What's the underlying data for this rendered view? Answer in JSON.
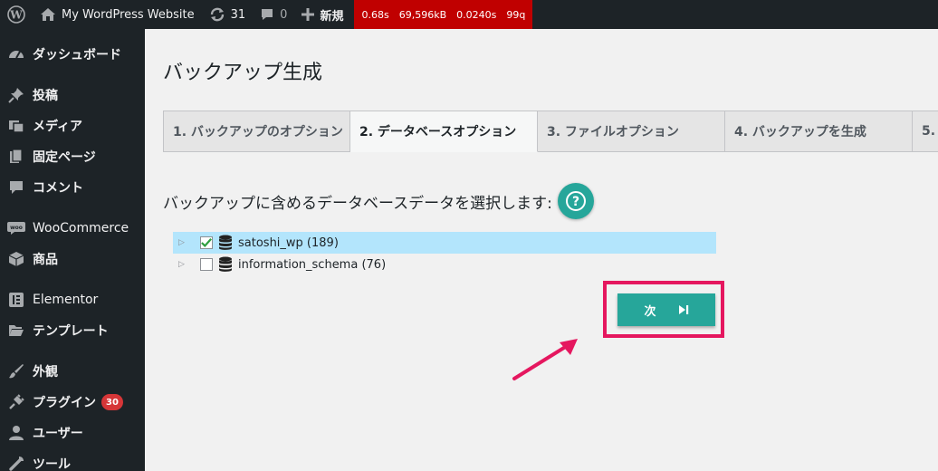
{
  "adminbar": {
    "site_name": "My WordPress Website",
    "updates_count": "31",
    "comments_count": "0",
    "new_label": "新規",
    "perf": {
      "time": "0.68s",
      "memory": "69,596kB",
      "query_time": "0.0240s",
      "queries": "99q"
    },
    "colors": {
      "bar": "#1d2327",
      "perf": "#c00000"
    }
  },
  "sidebar": {
    "items": [
      {
        "label": "ダッシュボード",
        "icon": "dashboard-icon"
      },
      {
        "label": "投稿",
        "icon": "pin-icon"
      },
      {
        "label": "メディア",
        "icon": "media-icon"
      },
      {
        "label": "固定ページ",
        "icon": "pages-icon"
      },
      {
        "label": "コメント",
        "icon": "comment-icon"
      },
      {
        "label": "WooCommerce",
        "icon": "woo-icon"
      },
      {
        "label": "商品",
        "icon": "box-icon"
      },
      {
        "label": "Elementor",
        "icon": "elementor-icon"
      },
      {
        "label": "テンプレート",
        "icon": "folder-icon"
      },
      {
        "label": "外観",
        "icon": "brush-icon"
      },
      {
        "label": "プラグイン",
        "icon": "plugin-icon",
        "badge": "30"
      },
      {
        "label": "ユーザー",
        "icon": "user-icon"
      },
      {
        "label": "ツール",
        "icon": "wrench-icon"
      }
    ]
  },
  "main": {
    "title": "バックアップ生成",
    "tabs": [
      {
        "label": "1. バックアップのオプション",
        "active": false
      },
      {
        "label": "2. データベースオプション",
        "active": true
      },
      {
        "label": "3. ファイルオプション",
        "active": false
      },
      {
        "label": "4. バックアップを生成",
        "active": false
      },
      {
        "label": "5.",
        "active": false
      }
    ],
    "question": "バックアップに含めるデータベースデータを選択します:",
    "databases": [
      {
        "name": "satoshi_wp (189)",
        "checked": true,
        "selected": true
      },
      {
        "name": "information_schema (76)",
        "checked": false,
        "selected": false
      }
    ],
    "next_label": "次",
    "accent_color": "#26a69a",
    "highlight_color": "#e5175f"
  }
}
